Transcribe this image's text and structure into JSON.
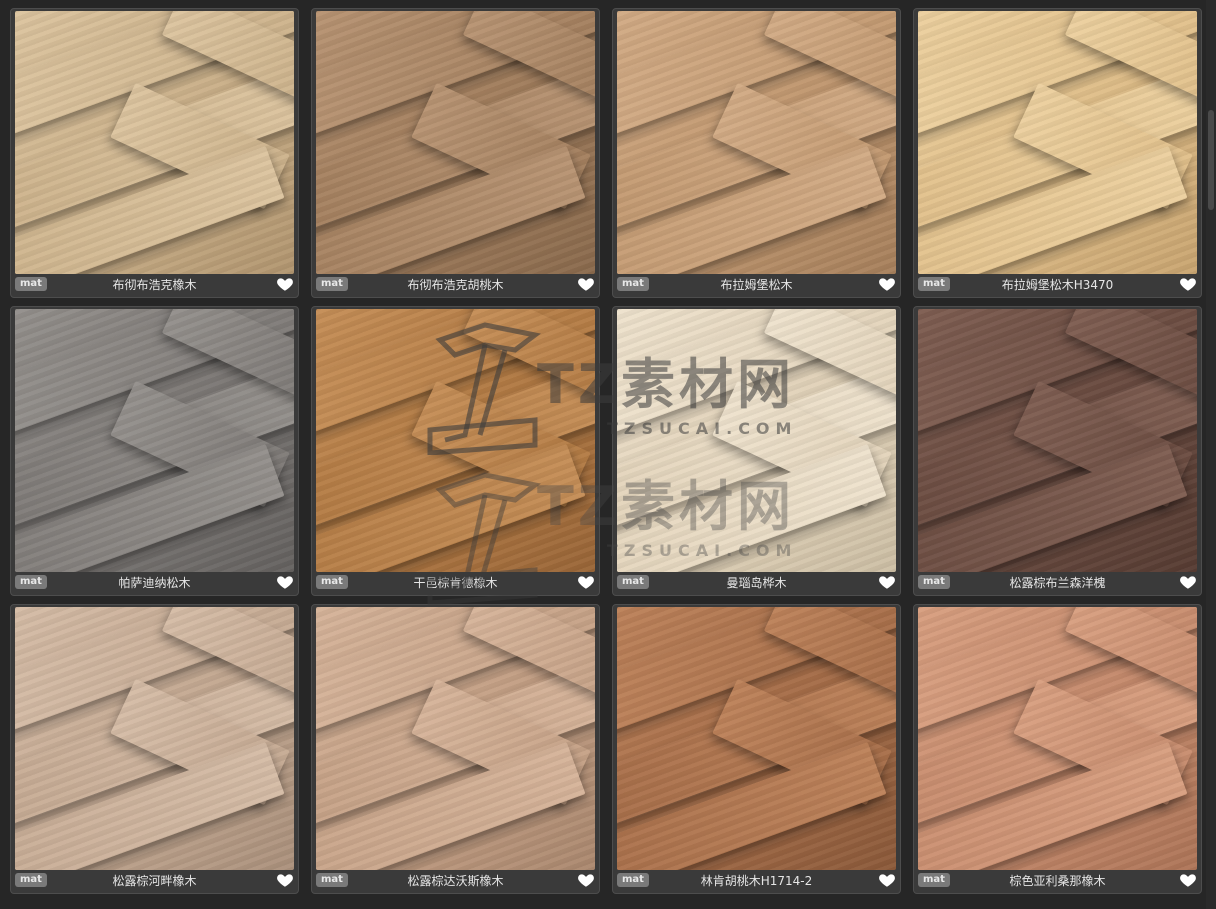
{
  "items": [
    {
      "badge": "mat",
      "name": "布彻布浩克橡木",
      "base": "#cdb38c",
      "dark": "#b29670",
      "light": "#dcc49f"
    },
    {
      "badge": "mat",
      "name": "布彻布浩克胡桃木",
      "base": "#a4805f",
      "dark": "#8a6a4d",
      "light": "#b89473"
    },
    {
      "badge": "mat",
      "name": "布拉姆堡松木",
      "base": "#c39a72",
      "dark": "#a7805c",
      "light": "#d2ab85"
    },
    {
      "badge": "mat",
      "name": "布拉姆堡松木H3470",
      "base": "#e1c08b",
      "dark": "#c9a571",
      "light": "#ecd09f"
    },
    {
      "badge": "mat",
      "name": "帕萨迪纳松木",
      "base": "#7f7b78",
      "dark": "#656260",
      "light": "#94908c"
    },
    {
      "badge": "mat",
      "name": "干邑棕肯德橡木",
      "base": "#b47c45",
      "dark": "#9a6638",
      "light": "#c58e57"
    },
    {
      "badge": "mat",
      "name": "曼瑙岛桦木",
      "base": "#e3d4bb",
      "dark": "#cdbfa5",
      "light": "#eee2cd"
    },
    {
      "badge": "mat",
      "name": "松露棕布兰森洋槐",
      "base": "#6c4d42",
      "dark": "#573c33",
      "light": "#7f5e52"
    },
    {
      "badge": "mat",
      "name": "松露棕河畔橡木",
      "base": "#c6ab94",
      "dark": "#ab917c",
      "light": "#d5bca6"
    },
    {
      "badge": "mat",
      "name": "松露棕达沃斯橡木",
      "base": "#c6a287",
      "dark": "#ab886f",
      "light": "#d6b49a"
    },
    {
      "badge": "mat",
      "name": "林肯胡桃木H1714-2",
      "base": "#a86f4a",
      "dark": "#8c5a3a",
      "light": "#bd825a"
    },
    {
      "badge": "mat",
      "name": "棕色亚利桑那橡木",
      "base": "#c88d6f",
      "dark": "#ae7558",
      "light": "#d89f80"
    }
  ],
  "watermark": {
    "text": "TZ素材网",
    "sub": "TZSUCAI.COM"
  },
  "icons": {
    "heart": "heart-icon",
    "logo": "tz-logo-mark"
  }
}
